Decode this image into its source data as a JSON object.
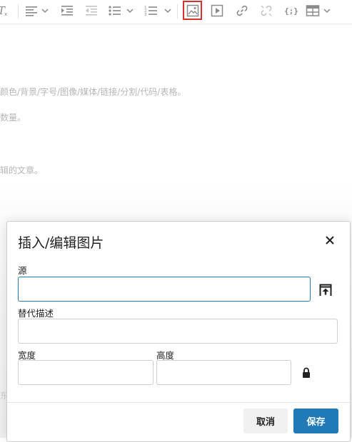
{
  "toolbar": {
    "buttons": [
      {
        "name": "clear-formatting",
        "icon": "clear-format-icon"
      },
      {
        "name": "align",
        "icon": "align-left-icon"
      },
      {
        "name": "indent",
        "icon": "indent-icon"
      },
      {
        "name": "outdent",
        "icon": "outdent-icon"
      },
      {
        "name": "bullet-list",
        "icon": "bullet-list-icon"
      },
      {
        "name": "numbered-list",
        "icon": "numbered-list-icon"
      },
      {
        "name": "image",
        "icon": "image-icon",
        "selected": true
      },
      {
        "name": "media",
        "icon": "play-icon"
      },
      {
        "name": "link",
        "icon": "link-icon"
      },
      {
        "name": "unlink",
        "icon": "unlink-icon"
      },
      {
        "name": "code-sample",
        "icon": "code-braces-icon"
      },
      {
        "name": "table",
        "icon": "table-icon"
      }
    ],
    "code_label": "{;}"
  },
  "background": {
    "line1": "颜色/背景/字号/图像/媒体/链接/分割/代码/表格。",
    "line2": "数量。",
    "line3": "辑的文章。",
    "line4": "东"
  },
  "dialog": {
    "title": "插入/编辑图片",
    "source_label": "源",
    "source_value": "",
    "alt_label": "替代描述",
    "alt_value": "",
    "width_label": "宽度",
    "width_value": "",
    "height_label": "高度",
    "height_value": "",
    "cancel_label": "取消",
    "save_label": "保存"
  },
  "colors": {
    "accent": "#207ab7",
    "selected_outline": "#d9302c",
    "icon_gray": "#8a8a8a"
  }
}
